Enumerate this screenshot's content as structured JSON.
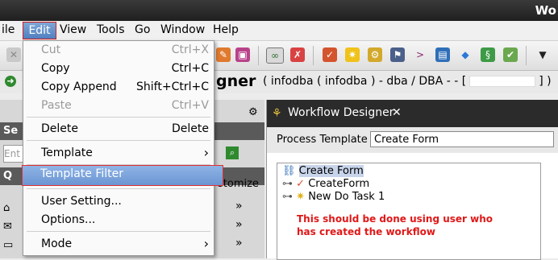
{
  "window": {
    "title": "Wo"
  },
  "menubar": {
    "items": [
      "ile",
      "Edit",
      "View",
      "Tools",
      "Go",
      "Window",
      "Help"
    ]
  },
  "header": {
    "title": "gner",
    "subtitle": "( infodba ( infodba ) - dba / DBA - - [",
    "subtitle_end": "] )"
  },
  "edit_menu": {
    "cut": {
      "label": "Cut",
      "shortcut": "Ctrl+X"
    },
    "copy": {
      "label": "Copy",
      "shortcut": "Ctrl+C"
    },
    "copy_append": {
      "label": "Copy Append",
      "shortcut": "Shift+Ctrl+C"
    },
    "paste": {
      "label": "Paste",
      "shortcut": "Ctrl+V"
    },
    "delete": {
      "label": "Delete",
      "shortcut": "Delete"
    },
    "template": {
      "label": "Template"
    },
    "template_filter": {
      "label": "Template Filter"
    },
    "user_setting": {
      "label": "User Setting..."
    },
    "options": {
      "label": "Options..."
    },
    "mode": {
      "label": "Mode"
    }
  },
  "left_panel": {
    "customize": "stomize",
    "partial_labels": [
      "Se",
      "Ent",
      "Q",
      "H",
      "M",
      "M"
    ]
  },
  "workflow": {
    "tab_title": "Workflow Designer",
    "process_template_label": "Process Template",
    "process_template_value": "Create Form",
    "tree": {
      "root": "Create Form",
      "children": [
        "CreateForm",
        "New Do Task 1"
      ]
    },
    "note_line1": "This should be done using user who",
    "note_line2": "has created the workflow"
  },
  "colors": {
    "accent": "#5b86c7",
    "note_red": "#e01818"
  }
}
